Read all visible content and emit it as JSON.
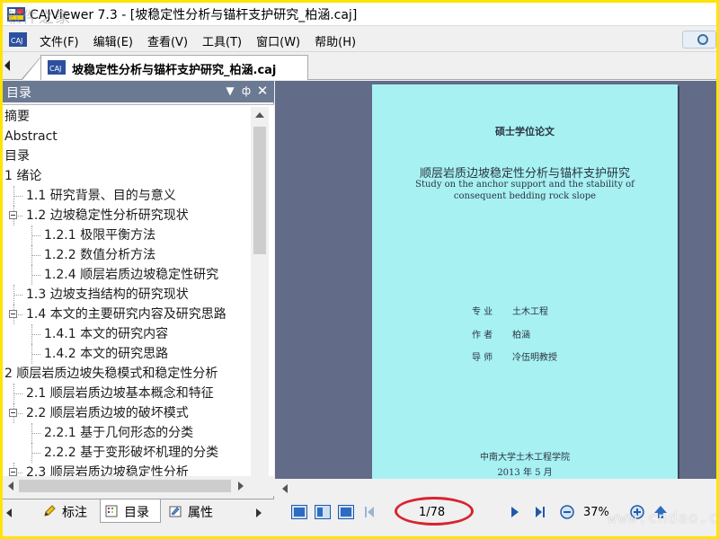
{
  "window": {
    "title": "CAJViewer 7.3 - [坡稳定性分析与锚杆支护研究_柏涵.caj]",
    "watermark": "软件之家"
  },
  "menu": {
    "items": [
      "文件(F)",
      "编辑(E)",
      "查看(V)",
      "工具(T)",
      "窗口(W)",
      "帮助(H)"
    ]
  },
  "doc_tab": {
    "label": "坡稳定性分析与锚杆支护研究_柏涵.caj"
  },
  "toc": {
    "header": "目录",
    "items": [
      {
        "label": "摘要",
        "level": 0,
        "expander": false
      },
      {
        "label": "Abstract",
        "level": 0,
        "expander": false
      },
      {
        "label": "目录",
        "level": 0,
        "expander": false
      },
      {
        "label": "1 绪论",
        "level": 0,
        "expander": false
      },
      {
        "label": "1.1 研究背景、目的与意义",
        "level": 1,
        "expander": false
      },
      {
        "label": "1.2 边坡稳定性分析研究现状",
        "level": 1,
        "expander": true
      },
      {
        "label": "1.2.1 极限平衡方法",
        "level": 2,
        "expander": false
      },
      {
        "label": "1.2.2 数值分析方法",
        "level": 2,
        "expander": false
      },
      {
        "label": "1.2.4 顺层岩质边坡稳定性研究",
        "level": 2,
        "expander": false
      },
      {
        "label": "1.3 边坡支挡结构的研究现状",
        "level": 1,
        "expander": false
      },
      {
        "label": "1.4 本文的主要研究内容及研究思路",
        "level": 1,
        "expander": true
      },
      {
        "label": "1.4.1 本文的研究内容",
        "level": 2,
        "expander": false
      },
      {
        "label": "1.4.2 本文的研究思路",
        "level": 2,
        "expander": false
      },
      {
        "label": "2 顺层岩质边坡失稳模式和稳定性分析",
        "level": 0,
        "expander": false
      },
      {
        "label": "2.1 顺层岩质边坡基本概念和特征",
        "level": 1,
        "expander": false
      },
      {
        "label": "2.2 顺层岩质边坡的破坏模式",
        "level": 1,
        "expander": true
      },
      {
        "label": "2.2.1 基于几何形态的分类",
        "level": 2,
        "expander": false
      },
      {
        "label": "2.2.2 基于变形破坏机理的分类",
        "level": 2,
        "expander": false
      },
      {
        "label": "2.3 顺层岩质边坡稳定性分析",
        "level": 1,
        "expander": true
      }
    ]
  },
  "panel_tabs": [
    {
      "label": "标注",
      "icon": "pencil-icon",
      "active": false
    },
    {
      "label": "目录",
      "icon": "toc-icon",
      "active": true
    },
    {
      "label": "属性",
      "icon": "properties-icon",
      "active": false
    }
  ],
  "page": {
    "degree_type": "硕士学位论文",
    "title_cn": "顺层岩质边坡稳定性分析与锚杆支护研究",
    "title_en_1": "Study on the anchor support and the stability of",
    "title_en_2": "consequent bedding rock slope",
    "fields": [
      {
        "label": "专  业",
        "value": "土木工程"
      },
      {
        "label": "作  者",
        "value": "柏涵"
      },
      {
        "label": "导  师",
        "value": "冷伍明教授"
      }
    ],
    "institution": "中南大学土木工程学院",
    "date": "2013 年 5 月"
  },
  "status": {
    "page_counter": "1/78",
    "zoom": "37%",
    "site_watermark": "www.cndao.com"
  },
  "colors": {
    "outer_border": "#ffe400",
    "panel_header": "#6b7a93",
    "doc_background": "#626b87",
    "page_background": "#a7f1f3",
    "highlight_ellipse": "#d8242e"
  }
}
